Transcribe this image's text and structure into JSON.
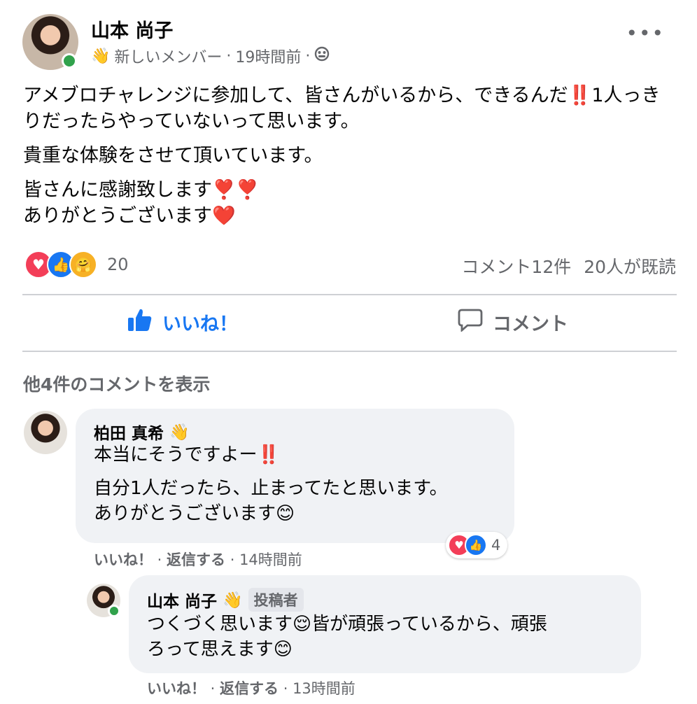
{
  "post": {
    "author": "山本 尚子",
    "badge_icon": "waving-hand-icon",
    "member_label": "新しいメンバー",
    "separator": "·",
    "time": "19時間前",
    "audience_icon": "group-icon",
    "more_label": "•••",
    "paragraph1": "アメブロチャレンジに参加して、皆さんがいるから、できるんだ",
    "paragraph1_emoji": "‼️",
    "paragraph1_end": "1人っきりだったらやっていないって思います。",
    "paragraph2": "貴重な体験をさせて頂いています。",
    "paragraph3_line1": "皆さんに感謝致します",
    "paragraph3_line1_emoji": "❣️❣️",
    "paragraph3_line2": "ありがとうございます",
    "paragraph3_line2_emoji": "❤️"
  },
  "reactions": {
    "icons": [
      "love-reaction-icon",
      "like-reaction-icon",
      "care-reaction-icon"
    ],
    "count": "20",
    "comment_count": "コメント12件",
    "seen_count": "20人が既読"
  },
  "actions": {
    "like_label": "いいね！",
    "comment_label": "コメント"
  },
  "view_more": "他4件のコメントを表示",
  "comments": [
    {
      "author": "柏田 真希",
      "badge_icon": "waving-hand-icon",
      "line1": "本当にそうですよー",
      "line1_emoji": "‼️",
      "line2": "自分1人だったら、止まってたと思います。",
      "line3": "ありがとうございます",
      "line3_emoji": "😊",
      "reaction_count": "4",
      "like": "いいね！",
      "reply": "返信する",
      "time": "14時間前"
    },
    {
      "author": "山本 尚子",
      "badge_icon": "waving-hand-icon",
      "author_badge": "投稿者",
      "line1a": "つくづく思います",
      "line1_emoji": "😌",
      "line1b": "皆が頑張っているから、頑張",
      "line2": "ろって思えます",
      "line2_emoji": "😊",
      "like": "いいね！",
      "reply": "返信する",
      "time": "13時間前"
    }
  ]
}
